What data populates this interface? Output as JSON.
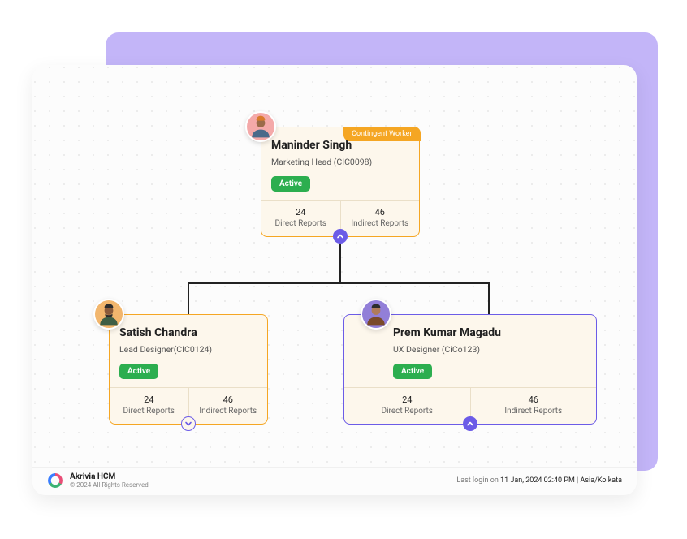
{
  "root": {
    "badge": "Contingent Worker",
    "name": "Maninder Singh",
    "role": "Marketing Head (CIC0098)",
    "status": "Active",
    "direct_count": "24",
    "direct_label": "Direct Reports",
    "indirect_count": "46",
    "indirect_label": "Indirect Reports"
  },
  "left": {
    "name": "Satish Chandra",
    "role": "Lead Designer(CIC0124)",
    "status": "Active",
    "direct_count": "24",
    "direct_label": "Direct Reports",
    "indirect_count": "46",
    "indirect_label": "Indirect Reports"
  },
  "right": {
    "name": "Prem Kumar Magadu",
    "role": "UX Designer (CiCo123)",
    "status": "Active",
    "direct_count": "24",
    "direct_label": "Direct Reports",
    "indirect_count": "46",
    "indirect_label": "Indirect Reports"
  },
  "footer": {
    "brand": "Akrivia HCM",
    "copyright": "© 2024 All Rights Reserved",
    "login_prefix": "Last login on ",
    "login_time": "11 Jan, 2024 02:40 PM",
    "login_sep": "  |  ",
    "login_tz": "Asia/Kolkata"
  }
}
